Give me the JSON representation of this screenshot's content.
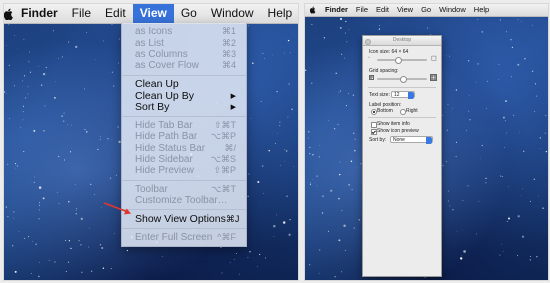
{
  "left": {
    "menubar": {
      "apple_icon": "apple-logo",
      "items": [
        "Finder",
        "File",
        "Edit",
        "View",
        "Go",
        "Window",
        "Help"
      ],
      "active": "View"
    },
    "view_menu": {
      "items": [
        {
          "label": "as Icons",
          "shortcut": "⌘1",
          "enabled": false
        },
        {
          "label": "as List",
          "shortcut": "⌘2",
          "enabled": false
        },
        {
          "label": "as Columns",
          "shortcut": "⌘3",
          "enabled": false
        },
        {
          "label": "as Cover Flow",
          "shortcut": "⌘4",
          "enabled": false
        },
        {
          "label": "Clean Up",
          "shortcut": "",
          "enabled": true
        },
        {
          "label": "Clean Up By",
          "shortcut": "▶",
          "enabled": true
        },
        {
          "label": "Sort By",
          "shortcut": "▶",
          "enabled": true
        },
        {
          "label": "Hide Tab Bar",
          "shortcut": "⇧⌘T",
          "enabled": false
        },
        {
          "label": "Hide Path Bar",
          "shortcut": "⌥⌘P",
          "enabled": false
        },
        {
          "label": "Hide Status Bar",
          "shortcut": "⌘/",
          "enabled": false
        },
        {
          "label": "Hide Sidebar",
          "shortcut": "⌥⌘S",
          "enabled": false
        },
        {
          "label": "Hide Preview",
          "shortcut": "⇧⌘P",
          "enabled": false
        },
        {
          "label": "Toolbar",
          "shortcut": "⌥⌘T",
          "enabled": false
        },
        {
          "label": "Customize Toolbar…",
          "shortcut": "",
          "enabled": false
        },
        {
          "label": "Show View Options",
          "shortcut": "⌘J",
          "enabled": true
        },
        {
          "label": "Enter Full Screen",
          "shortcut": "^⌘F",
          "enabled": false
        }
      ]
    },
    "annotation_color": "#e0362c"
  },
  "right": {
    "menubar": {
      "items": [
        "Finder",
        "File",
        "Edit",
        "View",
        "Go",
        "Window",
        "Help"
      ]
    },
    "view_options": {
      "title": "Desktop",
      "icon_size_label": "Icon size:",
      "icon_size_value": "64 × 64",
      "icon_size_level": 0.4,
      "grid_spacing_label": "Grid spacing:",
      "grid_spacing_level": 0.5,
      "text_size_label": "Text size:",
      "text_size_value": "12",
      "label_position_label": "Label position:",
      "label_bottom": "Bottom",
      "label_right": "Right",
      "label_position_selected": "Bottom",
      "show_item_info": "Show item info",
      "show_item_info_checked": false,
      "show_icon_preview": "Show icon preview",
      "show_icon_preview_checked": true,
      "sort_by_label": "Sort by:",
      "sort_by_value": "None"
    }
  },
  "colors": {
    "menu_highlight": "#3672d9",
    "select_accent": "#3a7ae0"
  }
}
